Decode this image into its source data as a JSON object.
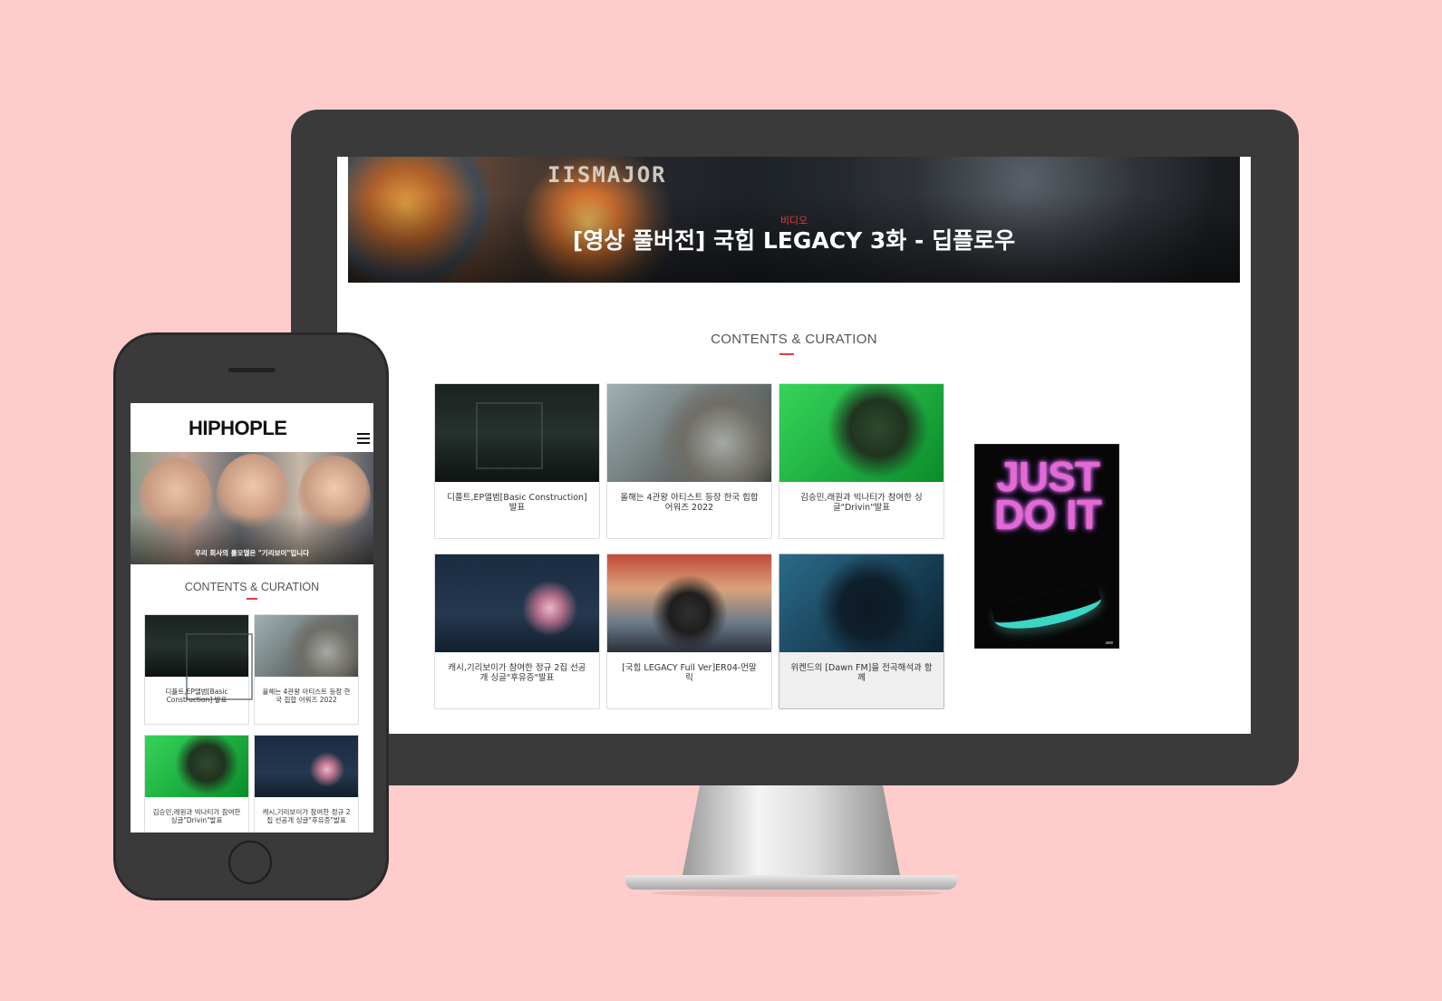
{
  "desktop": {
    "hero": {
      "brand_text": "IISMAJOR",
      "category": "비디오",
      "title": "[영상 풀버전] 국힙 LEGACY 3화 - 딥플로우"
    },
    "section_title": "CONTENTS & CURATION",
    "cards": [
      {
        "caption": "디플트,EP앨범[Basic Construction] 발표"
      },
      {
        "caption": "올해는 4관왕 아티스트 등장 한국 힙합 어워즈 2022"
      },
      {
        "caption": "김승민,래원과 빅나티가 참여한 싱글\"Drivin\"발표"
      },
      {
        "caption": "캐시,기리보이가 참여한 정규 2집 선공개 싱글\"후유증\"발표"
      },
      {
        "caption": "[국힙 LEGACY Full Ver]ER04-먼말릭"
      },
      {
        "caption": "위켄드의 [Dawn FM]을 전곡해석과 함께"
      }
    ],
    "ad": {
      "text": "JUST DO IT"
    }
  },
  "mobile": {
    "logo": "HIPHOPLE",
    "hero_caption": "우리 회사의 롤모델은 \"기리보이\"입니다",
    "section_title": "CONTENTS & CURATION",
    "cards": [
      {
        "caption": "디플트,EP앨범[Basic Construction] 발표"
      },
      {
        "caption": "올해는 4관왕 아티스트 등장 한국 힙합 어워즈 2022"
      },
      {
        "caption": "김승민,래원과 빅나티가 참여한 싱글\"Drivin\"발표"
      },
      {
        "caption": "캐시,기리보이가 참여한 정규 2집 선공개 싱글\"후유증\"발표"
      }
    ]
  },
  "colors": {
    "background": "#ffcccc",
    "device": "#3a3a3a",
    "accent": "#e13b3b"
  }
}
